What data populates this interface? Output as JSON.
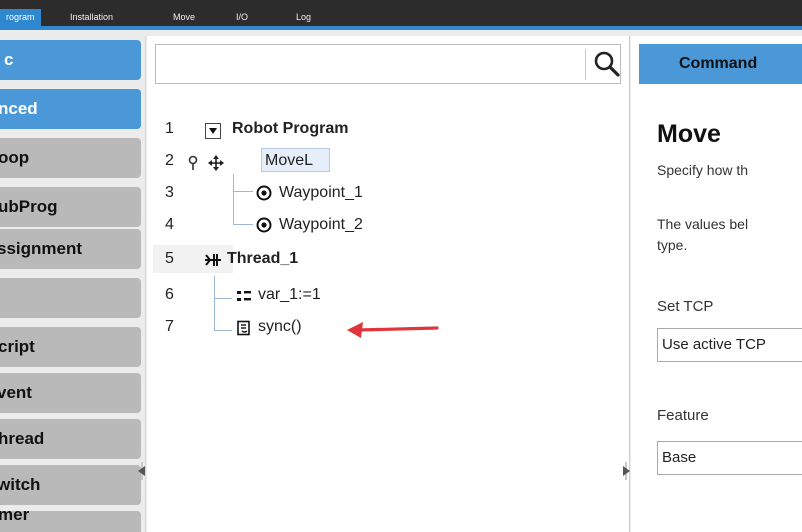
{
  "top_tabs": [
    "rogram",
    "Installation",
    "Move",
    "I/O",
    "Log"
  ],
  "sidebar": {
    "items": [
      "c",
      "nced",
      "oop",
      "ubProg",
      "ssignment",
      "",
      "cript",
      "vent",
      "hread",
      "witch",
      "mer"
    ]
  },
  "program_tree": {
    "search_placeholder": "",
    "line_numbers": [
      "1",
      "2",
      "3",
      "4",
      "5",
      "6",
      "7"
    ],
    "nodes": [
      "Robot Program",
      "MoveL",
      "Waypoint_1",
      "Waypoint_2",
      "Thread_1",
      "var_1:=1",
      "sync()"
    ]
  },
  "command_panel": {
    "tab_label": "Command",
    "title": "Move",
    "desc1": "Specify how th",
    "desc2": "The values bel",
    "desc3": "type.",
    "tcp_label": "Set TCP",
    "tcp_value": "Use active TCP",
    "feature_label": "Feature",
    "feature_value": "Base"
  },
  "colors": {
    "accent": "#4a98d8",
    "annotation_arrow": "#e0353a"
  }
}
